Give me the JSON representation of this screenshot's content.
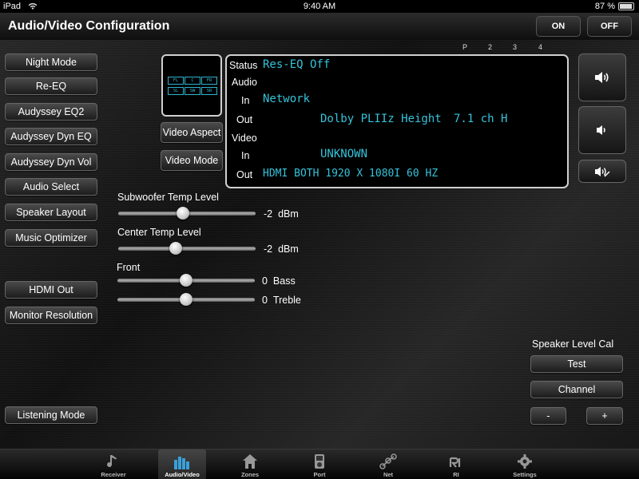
{
  "status_bar": {
    "device": "iPad",
    "time": "9:40 AM",
    "battery": "87 %"
  },
  "header": {
    "title": "Audio/Video Configuration",
    "on_label": "ON",
    "off_label": "OFF"
  },
  "left_buttons": [
    "Night Mode",
    "Re-EQ",
    "Audyssey EQ2",
    "Audyssey Dyn EQ",
    "Audyssey Dyn Vol",
    "Audio Select",
    "Speaker Layout",
    "Music Optimizer",
    "HDMI Out",
    "Monitor Resolution",
    "Listening Mode"
  ],
  "video_buttons": {
    "aspect": "Video Aspect",
    "mode": "Video Mode"
  },
  "speaker_diagram": {
    "labels": [
      "FL",
      "C",
      "FR",
      "SL",
      "SW",
      "SR"
    ],
    "color": "#2fb3cf"
  },
  "preset_numbers": [
    "P",
    "2",
    "3",
    "4"
  ],
  "display": {
    "status_label": "Status",
    "status_value": "Res-EQ Off",
    "audio_label": "Audio",
    "audio_in_label": "In",
    "audio_in_value": "Network",
    "audio_out_label": "Out",
    "audio_out_format": "Dolby PLIIz Height",
    "audio_out_channels": "7.1 ch H",
    "video_label": "Video",
    "video_in_label": "In",
    "video_in_value": "UNKNOWN",
    "video_out_label": "Out",
    "video_out_value": "HDMI BOTH 1920 X 1080I 60 HZ",
    "text_color": "#35c3da"
  },
  "sliders": {
    "subwoofer": {
      "label": "Subwoofer Temp Level",
      "value": "-2",
      "unit": "dBm",
      "level": 0.47
    },
    "center": {
      "label": "Center Temp Level",
      "value": "-2",
      "unit": "dBm",
      "level": 0.42
    },
    "front_label": "Front",
    "bass": {
      "value": "0",
      "unit": "Bass",
      "level": 0.5
    },
    "treble": {
      "value": "0",
      "unit": "Treble",
      "level": 0.5
    }
  },
  "speaker_cal": {
    "title": "Speaker Level Cal",
    "test": "Test",
    "channel": "Channel",
    "minus": "-",
    "plus": "+"
  },
  "tabs": [
    {
      "label": "Receiver",
      "icon": "music-note-icon"
    },
    {
      "label": "Audio/Video",
      "icon": "equalizer-icon",
      "active": true
    },
    {
      "label": "Zones",
      "icon": "house-icon"
    },
    {
      "label": "Port",
      "icon": "ipod-icon"
    },
    {
      "label": "Net",
      "icon": "network-icon"
    },
    {
      "label": "RI",
      "icon": "ri-icon"
    },
    {
      "label": "Settings",
      "icon": "gear-icon"
    }
  ]
}
